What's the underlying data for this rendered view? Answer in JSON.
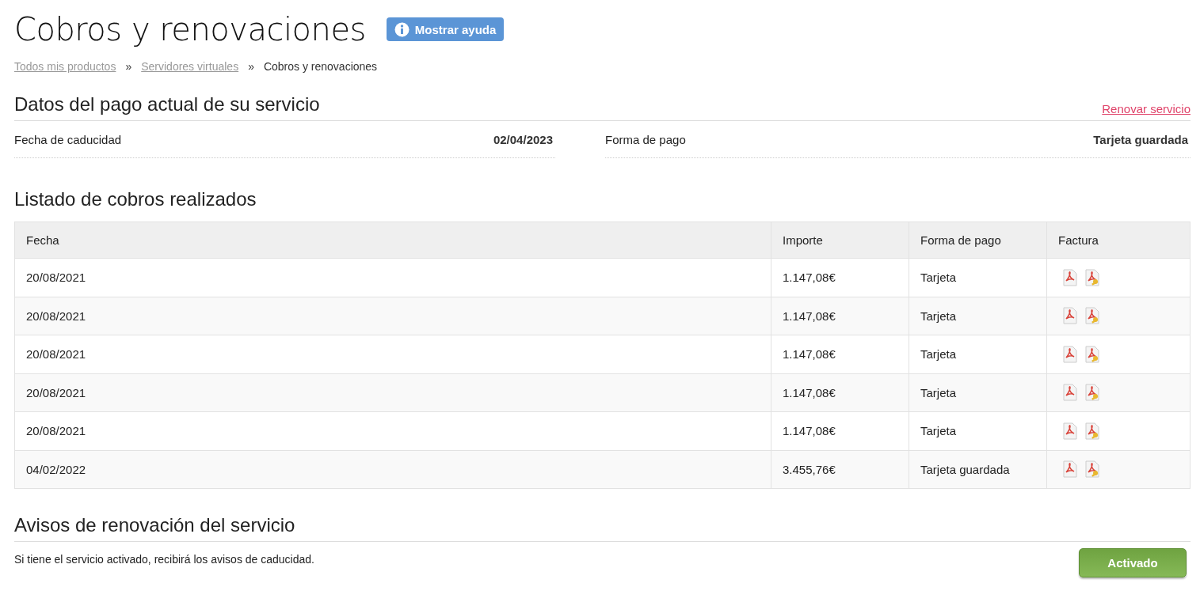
{
  "page": {
    "title": "Cobros y renovaciones",
    "help_button": "Mostrar ayuda"
  },
  "breadcrumb": [
    {
      "label": "Todos mis productos",
      "kind": "link"
    },
    {
      "label": "Servidores virtuales",
      "kind": "link"
    },
    {
      "label": "Cobros y renovaciones",
      "kind": "current"
    }
  ],
  "breadcrumb_separator": "»",
  "current_payment": {
    "heading": "Datos del pago actual de su servicio",
    "action": "Renovar servicio",
    "fields": [
      {
        "label": "Fecha de caducidad",
        "value": "02/04/2023"
      },
      {
        "label": "Forma de pago",
        "value": "Tarjeta guardada"
      }
    ]
  },
  "payments": {
    "heading": "Listado de cobros realizados",
    "columns": [
      "Fecha",
      "Importe",
      "Forma de pago",
      "Factura"
    ],
    "rows": [
      {
        "date": "20/08/2021",
        "amount": "1.147,08€",
        "method": "Tarjeta"
      },
      {
        "date": "20/08/2021",
        "amount": "1.147,08€",
        "method": "Tarjeta"
      },
      {
        "date": "20/08/2021",
        "amount": "1.147,08€",
        "method": "Tarjeta"
      },
      {
        "date": "20/08/2021",
        "amount": "1.147,08€",
        "method": "Tarjeta"
      },
      {
        "date": "20/08/2021",
        "amount": "1.147,08€",
        "method": "Tarjeta"
      },
      {
        "date": "04/02/2022",
        "amount": "3.455,76€",
        "method": "Tarjeta guardada"
      }
    ]
  },
  "renewal_notices": {
    "heading": "Avisos de renovación del servicio",
    "text": "Si tiene el servicio activado, recibirá los avisos de caducidad.",
    "button": {
      "label": "Activado",
      "on": true
    }
  }
}
